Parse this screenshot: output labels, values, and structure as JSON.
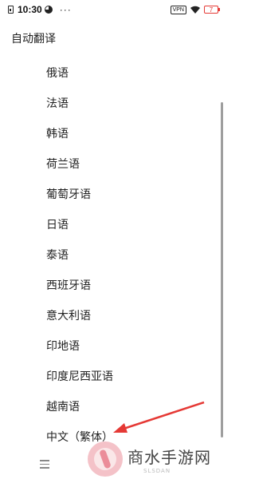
{
  "status_bar": {
    "time": "10:30",
    "more": "···",
    "vpn": "VPN",
    "battery": "7"
  },
  "header": {
    "title": "自动翻译"
  },
  "languages": [
    "俄语",
    "法语",
    "韩语",
    "荷兰语",
    "葡萄牙语",
    "日语",
    "泰语",
    "西班牙语",
    "意大利语",
    "印地语",
    "印度尼西亚语",
    "越南语",
    "中文（繁体）"
  ],
  "watermark": {
    "title": "商水手游网",
    "subtitle": "SLSDAN"
  },
  "colors": {
    "arrow": "#e53935",
    "battery": "#e53935",
    "scrollbar": "#9e9e9e"
  }
}
